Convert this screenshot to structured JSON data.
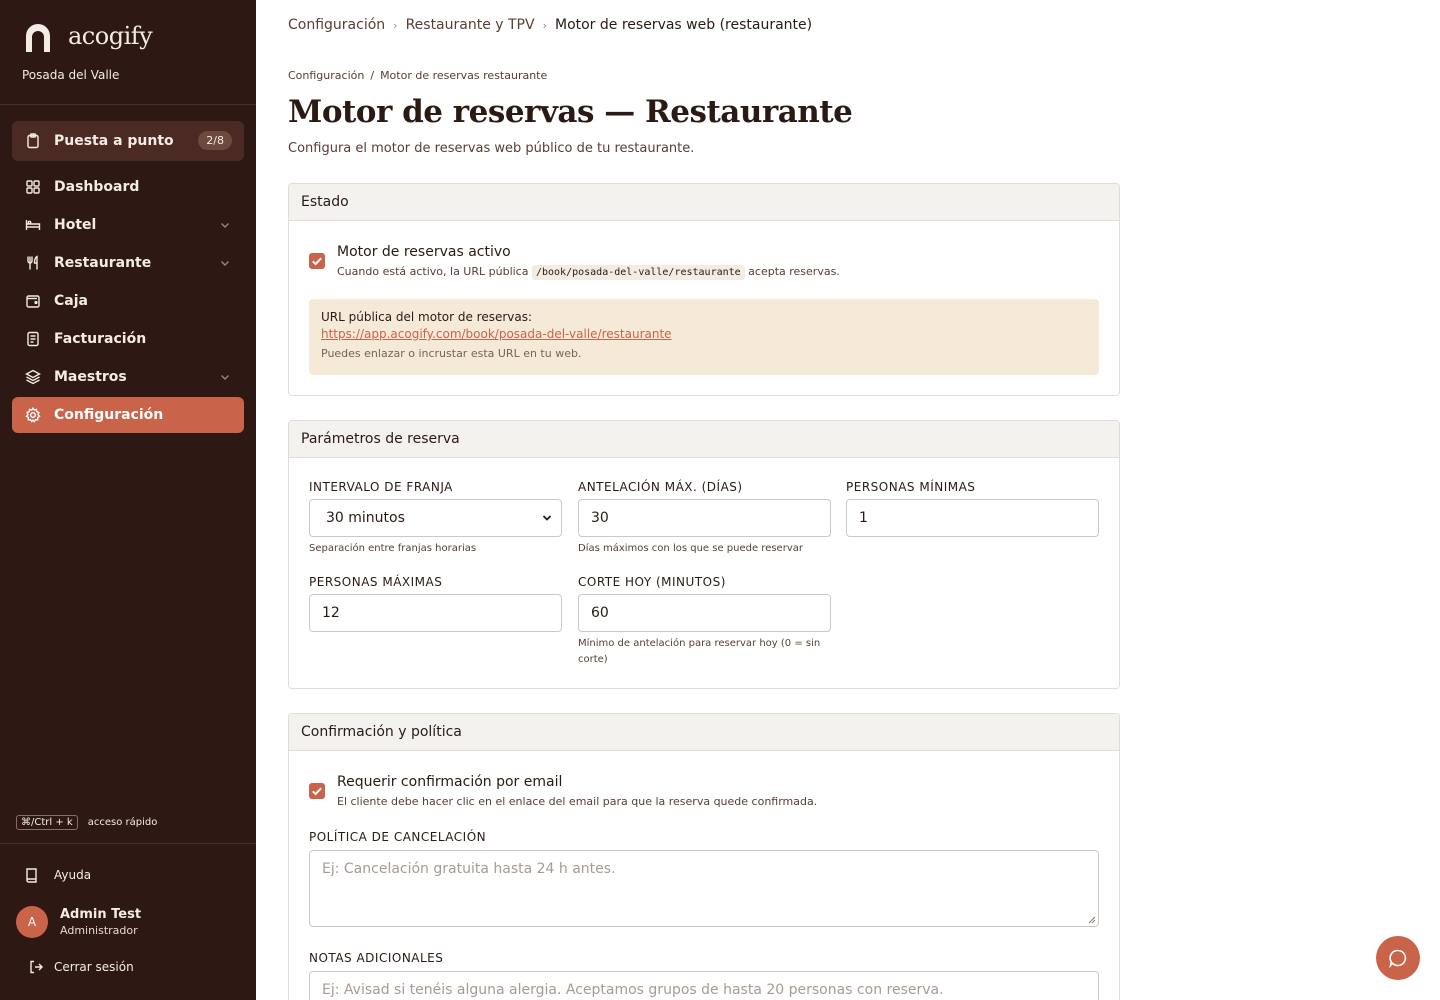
{
  "sidebar": {
    "brand": "acogify",
    "property": "Posada del Valle",
    "setup": {
      "label": "Puesta a punto",
      "badge": "2/8"
    },
    "items": [
      {
        "label": "Dashboard"
      },
      {
        "label": "Hotel"
      },
      {
        "label": "Restaurante"
      },
      {
        "label": "Caja"
      },
      {
        "label": "Facturación"
      },
      {
        "label": "Maestros"
      },
      {
        "label": "Configuración"
      }
    ],
    "shortcut": {
      "keys": "⌘/Ctrl + k",
      "label": "acceso rápido"
    },
    "help": "Ayuda",
    "user": {
      "initial": "A",
      "name": "Admin Test",
      "role": "Administrador"
    },
    "logout": "Cerrar sesión"
  },
  "topbar": {
    "breadcrumb": [
      "Configuración",
      "Restaurante y TPV",
      "Motor de reservas web (restaurante)"
    ]
  },
  "page": {
    "breadcrumb": [
      "Configuración",
      "Motor de reservas restaurante"
    ],
    "title": "Motor de reservas — Restaurante",
    "subtitle": "Configura el motor de reservas web público de tu restaurante."
  },
  "estado": {
    "title": "Estado",
    "active_label": "Motor de reservas activo",
    "active_help_before": "Cuando está activo, la URL pública",
    "active_help_code": "/book/posada-del-valle/restaurante",
    "active_help_after": "acepta reservas.",
    "url_label": "URL pública del motor de reservas:",
    "url": "https://app.acogify.com/book/posada-del-valle/restaurante",
    "url_help": "Puedes enlazar o incrustar esta URL en tu web."
  },
  "params": {
    "title": "Parámetros de reserva",
    "interval": {
      "label": "INTERVALO DE FRANJA",
      "value": "30 minutos",
      "help": "Separación entre franjas horarias"
    },
    "advance": {
      "label": "ANTELACIÓN MÁX. (DÍAS)",
      "value": "30",
      "help": "Días máximos con los que se puede reservar"
    },
    "min_people": {
      "label": "PERSONAS MÍNIMAS",
      "value": "1"
    },
    "max_people": {
      "label": "PERSONAS MÁXIMAS",
      "value": "12"
    },
    "cutoff": {
      "label": "CORTE HOY (MINUTOS)",
      "value": "60",
      "help": "Mínimo de antelación para reservar hoy (0 = sin corte)"
    }
  },
  "policy": {
    "title": "Confirmación y política",
    "confirm_label": "Requerir confirmación por email",
    "confirm_help": "El cliente debe hacer clic en el enlace del email para que la reserva quede confirmada.",
    "cancel_label": "POLÍTICA DE CANCELACIÓN",
    "cancel_placeholder": "Ej: Cancelación gratuita hasta 24 h antes.",
    "notes_label": "NOTAS ADICIONALES",
    "notes_placeholder": "Ej: Avisad si tenéis alguna alergia. Aceptamos grupos de hasta 20 personas con reserva."
  },
  "colors": {
    "sidebar": "#2d1813",
    "accent": "#c9644a",
    "url_box": "#f5ead8"
  }
}
